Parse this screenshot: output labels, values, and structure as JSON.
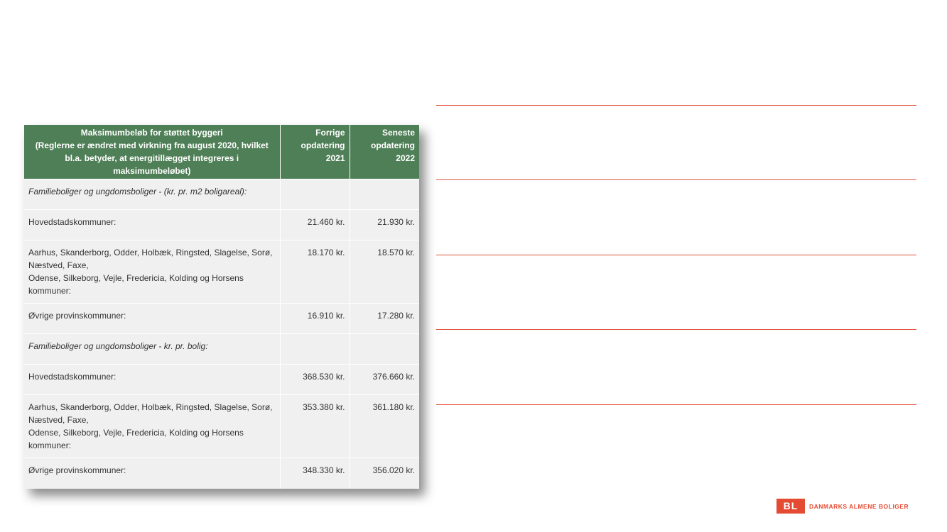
{
  "table": {
    "header": {
      "title": "Maksimumbeløb for støttet byggeri\n(Reglerne er ændret med virkning fra august 2020, hvilket bl.a. betyder, at energitillægget integreres i maksimumbeløbet)",
      "prev": "Forrige\nopdatering\n2021",
      "latest": "Seneste\nopdatering\n2022"
    },
    "rows": [
      {
        "desc": "Familieboliger og ungdomsboliger - (kr. pr. m2 boligareal):",
        "prev": "",
        "latest": ""
      },
      {
        "desc": "Hovedstadskommuner:",
        "prev": "21.460 kr.",
        "latest": "21.930 kr."
      },
      {
        "desc": "Aarhus, Skanderborg, Odder, Holbæk, Ringsted, Slagelse, Sorø, Næstved, Faxe,\nOdense, Silkeborg, Vejle, Fredericia, Kolding og Horsens kommuner:",
        "prev": "18.170 kr.",
        "latest": "18.570 kr."
      },
      {
        "desc": "Øvrige provinskommuner:",
        "prev": "16.910 kr.",
        "latest": "17.280 kr."
      },
      {
        "desc": "Familieboliger og ungdomsboliger - kr. pr. bolig:",
        "prev": "",
        "latest": ""
      },
      {
        "desc": "Hovedstadskommuner:",
        "prev": "368.530 kr.",
        "latest": "376.660 kr."
      },
      {
        "desc": "Aarhus, Skanderborg, Odder, Holbæk, Ringsted, Slagelse, Sorø, Næstved, Faxe,\nOdense, Silkeborg, Vejle, Fredericia, Kolding og Horsens kommuner:",
        "prev": "353.380 kr.",
        "latest": "361.180 kr."
      },
      {
        "desc": "Øvrige provinskommuner:",
        "prev": "348.330 kr.",
        "latest": "356.020 kr."
      }
    ]
  },
  "logo": {
    "mark": "BL",
    "text": "DANMARKS ALMENE BOLIGER",
    "color": "#e54b32"
  },
  "colors": {
    "header_bg": "#4f7f57",
    "row_bg": "#f0f0f0",
    "rule": "#e0523c"
  }
}
